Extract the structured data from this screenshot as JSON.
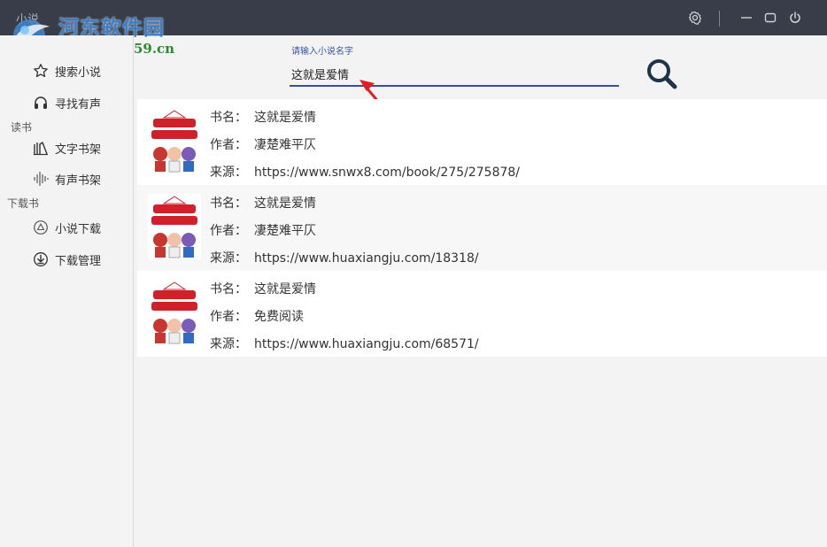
{
  "window": {
    "app_title": "小说",
    "watermark_title": "河东软件园",
    "watermark_url": "www.pc0359.cn"
  },
  "sidebar": {
    "items": [
      {
        "label": "搜索小说",
        "icon": "star-icon"
      },
      {
        "label": "寻找有声",
        "icon": "headphones-icon"
      },
      {
        "label": "文字书架",
        "icon": "books-icon"
      },
      {
        "label": "有声书架",
        "icon": "waveform-icon"
      },
      {
        "label": "小说下载",
        "icon": "circle-triangle-icon"
      },
      {
        "label": "下载管理",
        "icon": "download-circle-icon"
      }
    ],
    "sections": {
      "read": "读书",
      "download": "下载书"
    }
  },
  "search": {
    "label": "请输入小说名字",
    "value": "这就是爱情"
  },
  "result_labels": {
    "book": "书名：",
    "author": "作者：",
    "source": "来源："
  },
  "results": [
    {
      "book": "这就是爱情",
      "author": "凄楚难平仄",
      "source": "https://www.snwx8.com/book/275/275878/"
    },
    {
      "book": "这就是爱情",
      "author": "凄楚难平仄",
      "source": "https://www.huaxiangju.com/18318/"
    },
    {
      "book": "这就是爱情",
      "author": "免费阅读",
      "source": "https://www.huaxiangju.com/68571/"
    }
  ],
  "colors": {
    "titlebar": "#393d49",
    "accent": "#3a4fa0",
    "arrow": "#e02020",
    "cover_text": "#d0202a"
  }
}
